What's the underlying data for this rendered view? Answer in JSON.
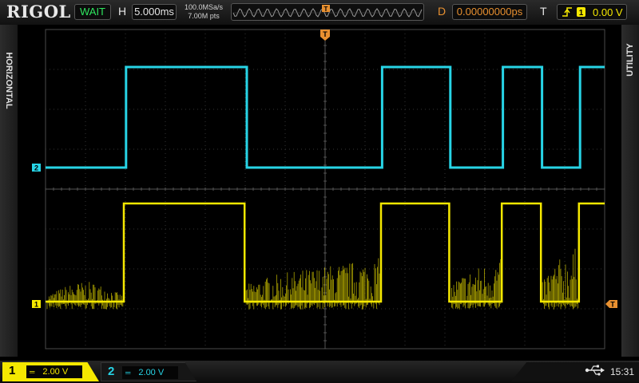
{
  "brand": "RIGOL",
  "status": "WAIT",
  "horizontal": {
    "label": "H",
    "timebase": "5.000ms",
    "sample_rate": "100.0MSa/s",
    "memory_depth": "7.00M pts",
    "trigger_marker": "T"
  },
  "delay": {
    "label": "D",
    "value": "0.00000000ps"
  },
  "trigger": {
    "label": "T",
    "edge_icon": "rising-edge-icon",
    "source": "1",
    "level": "0.00 V"
  },
  "side_tabs": {
    "left": "HORIZONTAL",
    "right": "UTILITY"
  },
  "markers": {
    "ch1": "1",
    "ch2": "2",
    "trigger_top": "T",
    "trigger_level": "T"
  },
  "channels": [
    {
      "number": "1",
      "coupling": "═",
      "scale": "2.00 V",
      "color": "#f5e800"
    },
    {
      "number": "2",
      "coupling": "═",
      "scale": "2.00 V",
      "color": "#27d4e6"
    }
  ],
  "clock": "15:31",
  "usb_icon": "usb-icon",
  "colors": {
    "ch1": "#f5e800",
    "ch2": "#27d4e6",
    "trigger": "#e89030",
    "grid": "#3a3a3a"
  },
  "waveforms": {
    "time_range_ms": [
      -25,
      25
    ],
    "ch1_transitions_ms": [
      -18.0,
      -7.2,
      5.0,
      11.1,
      15.8,
      19.3,
      22.7
    ],
    "ch2_transitions_ms": [
      -17.8,
      -7.0,
      5.1,
      11.2,
      15.9,
      19.4,
      22.8
    ]
  }
}
